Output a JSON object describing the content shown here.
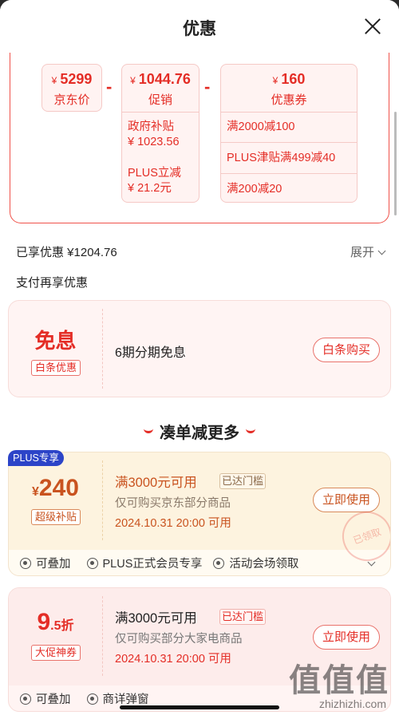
{
  "header": {
    "title": "优惠"
  },
  "price": {
    "jd": {
      "currency": "¥",
      "amount": "5299",
      "label": "京东价"
    },
    "promo": {
      "currency": "¥",
      "amount": "1044.76",
      "label": "促销"
    },
    "coupon": {
      "currency": "¥",
      "amount": "160",
      "label": "优惠券"
    },
    "promo_items": [
      "政府补贴",
      "¥ 1023.56",
      "PLUS立减",
      "¥ 21.2元"
    ],
    "coupon_items": [
      "满2000减100",
      "PLUS津贴满499减40",
      "满200减20"
    ]
  },
  "summary": {
    "enjoyed": "已享优惠 ¥1204.76",
    "expand": "展开"
  },
  "pay": {
    "title": "支付再享优惠",
    "free": "免息",
    "tag": "白条优惠",
    "desc": "6期分期免息",
    "button": "白条购买"
  },
  "section": {
    "title": "凑单减更多"
  },
  "card1": {
    "badge": "PLUS专享",
    "currency": "¥",
    "amount": "240",
    "tag": "超级补贴",
    "condition": "满3000元可用",
    "reached": "已达门槛",
    "scope": "仅可购买京东部分商品",
    "time": "2024.10.31 20:00 可用",
    "button": "立即使用",
    "stamp": "已领取",
    "footer": [
      "可叠加",
      "PLUS正式会员专享",
      "活动会场领取"
    ]
  },
  "card2": {
    "amount_main": "9",
    "amount_frac": ".5折",
    "tag": "大促神券",
    "condition": "满3000元可用",
    "reached": "已达门槛",
    "scope": "仅可购买部分大家电商品",
    "time": "2024.10.31 20:00 可用",
    "button": "立即使用",
    "footer": [
      "可叠加",
      "商详弹窗"
    ]
  },
  "watermark": {
    "logo": "值值值",
    "url": "zhizhizhi.com"
  },
  "colors": {
    "accent": "#e42d26",
    "plus_badge": "#2c44c8",
    "card_bg": "#fff4f3"
  }
}
